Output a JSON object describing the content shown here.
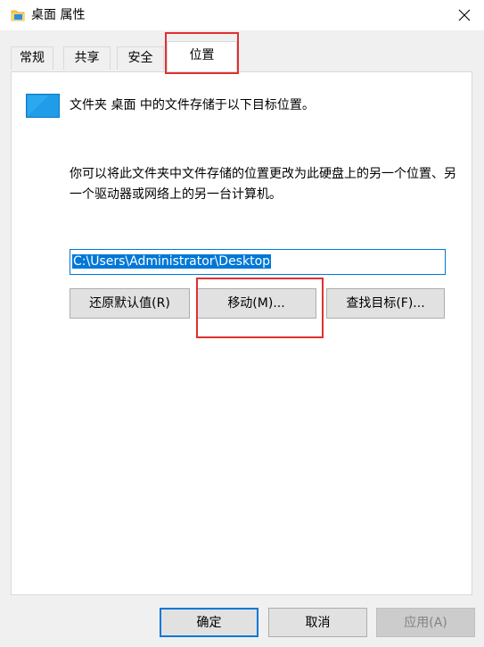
{
  "window": {
    "title": "桌面 属性",
    "close_glyph": "✕"
  },
  "tabs": [
    {
      "label": "常规",
      "active": false
    },
    {
      "label": "共享",
      "active": false
    },
    {
      "label": "安全",
      "active": false
    },
    {
      "label": "位置",
      "active": true
    }
  ],
  "location": {
    "description": "文件夹 桌面 中的文件存储于以下目标位置。",
    "instructions": "你可以将此文件夹中文件存储的位置更改为此硬盘上的另一个位置、另一个驱动器或网络上的另一台计算机。",
    "path_value": "C:\\Users\\Administrator\\Desktop",
    "restore_default_label": "还原默认值(R)",
    "move_label": "移动(M)...",
    "find_target_label": "查找目标(F)..."
  },
  "footer": {
    "ok_label": "确定",
    "cancel_label": "取消",
    "apply_label": "应用(A)"
  },
  "colors": {
    "accent": "#0078d7",
    "highlight": "#e03030",
    "folder_yellow": "#f8c94c",
    "desktop_blue": "#1e9ae8"
  },
  "icons": {
    "title": "folder-icon",
    "close": "close-icon",
    "location": "desktop-folder-icon"
  }
}
